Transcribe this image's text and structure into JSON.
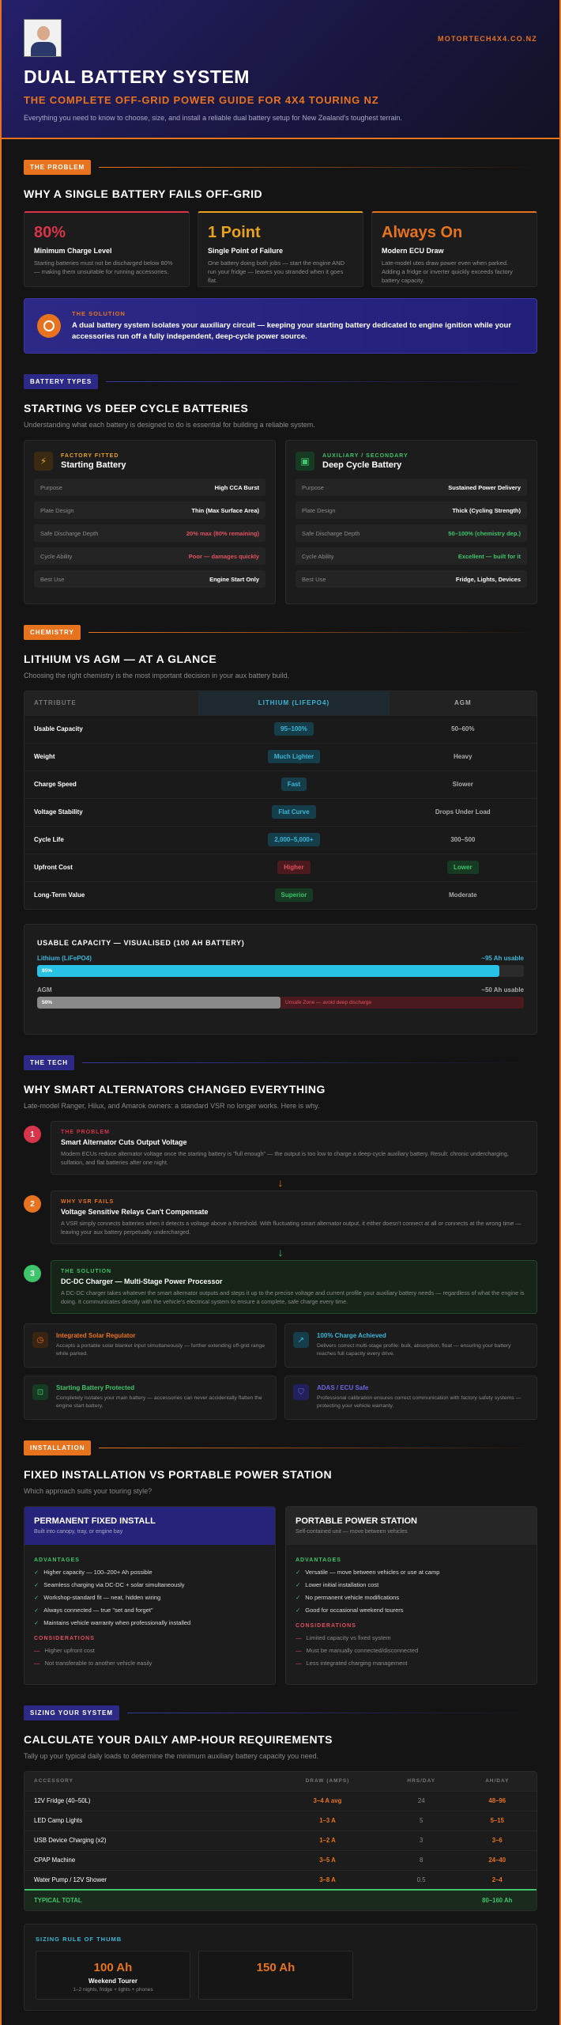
{
  "hero": {
    "site": "MOTORTECH4X4.CO.NZ",
    "title": "DUAL BATTERY SYSTEM",
    "subtitle": "THE COMPLETE OFF-GRID POWER GUIDE FOR 4X4 TOURING NZ",
    "intro": "Everything you need to know to choose, size, and install a reliable dual battery setup for New Zealand's toughest terrain."
  },
  "problem": {
    "tag": "THE PROBLEM",
    "title": "WHY A SINGLE BATTERY FAILS OFF-GRID",
    "cards": [
      {
        "big": "80%",
        "label": "Minimum Charge Level",
        "desc": "Starting batteries must not be discharged below 80% — making them unsuitable for running accessories.",
        "color": "#d8344a"
      },
      {
        "big": "1 Point",
        "label": "Single Point of Failure",
        "desc": "One battery doing both jobs — start the engine AND run your fridge — leaves you stranded when it goes flat.",
        "color": "#e8a21f"
      },
      {
        "big": "Always On",
        "label": "Modern ECU Draw",
        "desc": "Late-model utes draw power even when parked. Adding a fridge or inverter quickly exceeds factory battery capacity.",
        "color": "#e8731f"
      }
    ],
    "solution_kicker": "THE SOLUTION",
    "solution_text": "A dual battery system isolates your auxiliary circuit — keeping your starting battery dedicated to engine ignition while your accessories run off a fully independent, deep-cycle power source."
  },
  "types": {
    "tag": "BATTERY TYPES",
    "title": "STARTING VS DEEP CYCLE BATTERIES",
    "sub": "Understanding what each battery is designed to do is essential for building a reliable system.",
    "starting": {
      "kicker": "FACTORY FITTED",
      "name": "Starting Battery",
      "rows": [
        {
          "l": "Purpose",
          "v": "High CCA Burst",
          "c": "#ffffff"
        },
        {
          "l": "Plate Design",
          "v": "Thin (Max Surface Area)",
          "c": "#ffffff"
        },
        {
          "l": "Safe Discharge Depth",
          "v": "20% max (80% remaining)",
          "c": "#e05060"
        },
        {
          "l": "Cycle Ability",
          "v": "Poor — damages quickly",
          "c": "#e05060"
        },
        {
          "l": "Best Use",
          "v": "Engine Start Only",
          "c": "#ffffff"
        }
      ]
    },
    "deep": {
      "kicker": "AUXILIARY / SECONDARY",
      "name": "Deep Cycle Battery",
      "rows": [
        {
          "l": "Purpose",
          "v": "Sustained Power Delivery",
          "c": "#ffffff"
        },
        {
          "l": "Plate Design",
          "v": "Thick (Cycling Strength)",
          "c": "#ffffff"
        },
        {
          "l": "Safe Discharge Depth",
          "v": "50–100% (chemistry dep.)",
          "c": "#3ec46a"
        },
        {
          "l": "Cycle Ability",
          "v": "Excellent — built for it",
          "c": "#3ec46a"
        },
        {
          "l": "Best Use",
          "v": "Fridge, Lights, Devices",
          "c": "#ffffff"
        }
      ]
    }
  },
  "chem": {
    "tag": "CHEMISTRY",
    "title": "LITHIUM VS AGM — AT A GLANCE",
    "sub": "Choosing the right chemistry is the most important decision in your aux battery build.",
    "headers": [
      "ATTRIBUTE",
      "LITHIUM (LIFEPO4)",
      "AGM"
    ],
    "rows": [
      {
        "a": "Usable Capacity",
        "li": "95–100%",
        "lic": "cy",
        "ag": "50–60%",
        "agc": "plain"
      },
      {
        "a": "Weight",
        "li": "Much Lighter",
        "lic": "cy",
        "ag": "Heavy",
        "agc": "plain"
      },
      {
        "a": "Charge Speed",
        "li": "Fast",
        "lic": "cy",
        "ag": "Slower",
        "agc": "plain"
      },
      {
        "a": "Voltage Stability",
        "li": "Flat Curve",
        "lic": "cy",
        "ag": "Drops Under Load",
        "agc": "plain"
      },
      {
        "a": "Cycle Life",
        "li": "2,000–5,000+",
        "lic": "cy",
        "ag": "300–500",
        "agc": "plain"
      },
      {
        "a": "Upfront Cost",
        "li": "Higher",
        "lic": "rd",
        "ag": "Lower",
        "agc": "gr"
      },
      {
        "a": "Long-Term Value",
        "li": "Superior",
        "lic": "gr",
        "ag": "Moderate",
        "agc": "plain"
      }
    ],
    "cap_title": "USABLE CAPACITY — VISUALISED (100 AH BATTERY)",
    "li_label": "Lithium (LiFePO4)",
    "li_usable": "~95 Ah usable",
    "li_pct": "95%",
    "li_frac": 0.95,
    "agm_label": "AGM",
    "agm_usable": "~50 Ah usable",
    "agm_pct": "50%",
    "agm_frac": 0.5,
    "unsafe_label": "Unsafe Zone — avoid deep discharge"
  },
  "tech": {
    "tag": "THE TECH",
    "title": "WHY SMART ALTERNATORS CHANGED EVERYTHING",
    "sub": "Late-model Ranger, Hilux, and Amarok owners: a standard VSR no longer works. Here is why.",
    "steps": [
      {
        "n": "1",
        "k": "THE PROBLEM",
        "t": "Smart Alternator Cuts Output Voltage",
        "d": "Modern ECUs reduce alternator voltage once the starting battery is \"full enough\" — the output is too low to charge a deep-cycle auxiliary battery. Result: chronic undercharging, sulfation, and flat batteries after one night.",
        "color": "#d8344a"
      },
      {
        "n": "2",
        "k": "WHY VSR FAILS",
        "t": "Voltage Sensitive Relays Can't Compensate",
        "d": "A VSR simply connects batteries when it detects a voltage above a threshold. With fluctuating smart alternator output, it either doesn't connect at all or connects at the wrong time — leaving your aux battery perpetually undercharged.",
        "color": "#e8731f"
      },
      {
        "n": "3",
        "k": "THE SOLUTION",
        "t": "DC-DC Charger — Multi-Stage Power Processor",
        "d": "A DC-DC charger takes whatever the smart alternator outputs and steps it up to the precise voltage and current profile your auxiliary battery needs — regardless of what the engine is doing. It communicates directly with the vehicle's electrical system to ensure a complete, safe charge every time.",
        "color": "#3ec46a"
      }
    ],
    "features": [
      {
        "t": "Integrated Solar Regulator",
        "d": "Accepts a portable solar blanket input simultaneously — further extending off-grid range while parked.",
        "color": "#e8731f",
        "icon": "◷"
      },
      {
        "t": "100% Charge Achieved",
        "d": "Delivers correct multi-stage profile: bulk, absorption, float — ensuring your battery reaches full capacity every drive.",
        "color": "#3bb6d8",
        "icon": "↗"
      },
      {
        "t": "Starting Battery Protected",
        "d": "Completely isolates your main battery — accessories can never accidentally flatten the engine start battery.",
        "color": "#3ec46a",
        "icon": "🔒"
      },
      {
        "t": "ADAS / ECU Safe",
        "d": "Professional calibration ensures correct communication with factory safety systems — protecting your vehicle warranty.",
        "color": "#6a66e8",
        "icon": "⛉"
      }
    ]
  },
  "install": {
    "tag": "INSTALLATION",
    "title": "FIXED INSTALLATION VS PORTABLE POWER STATION",
    "sub": "Which approach suits your touring style?",
    "fixed": {
      "name": "PERMANENT FIXED INSTALL",
      "desc": "Built into canopy, tray, or engine bay",
      "adv_label": "ADVANTAGES",
      "adv": [
        "Higher capacity — 100–200+ Ah possible",
        "Seamless charging via DC-DC + solar simultaneously",
        "Workshop-standard fit — neat, hidden wiring",
        "Always connected — true \"set and forget\"",
        "Maintains vehicle warranty when professionally installed"
      ],
      "con_label": "CONSIDERATIONS",
      "con": [
        "Higher upfront cost",
        "Not transferable to another vehicle easily"
      ]
    },
    "portable": {
      "name": "PORTABLE POWER STATION",
      "desc": "Self-contained unit — move between vehicles",
      "adv_label": "ADVANTAGES",
      "adv": [
        "Versatile — move between vehicles or use at camp",
        "Lower initial installation cost",
        "No permanent vehicle modifications",
        "Good for occasional weekend tourers"
      ],
      "con_label": "CONSIDERATIONS",
      "con": [
        "Limited capacity vs fixed system",
        "Must be manually connected/disconnected",
        "Less integrated charging management"
      ]
    }
  },
  "sizing": {
    "tag": "SIZING YOUR SYSTEM",
    "title": "CALCULATE YOUR DAILY AMP-HOUR REQUIREMENTS",
    "sub": "Tally up your typical daily loads to determine the minimum auxiliary battery capacity you need.",
    "headers": [
      "ACCESSORY",
      "DRAW (AMPS)",
      "HRS/DAY",
      "AH/DAY"
    ],
    "rows": [
      {
        "a": "12V Fridge (40–50L)",
        "d": "3–4 A avg",
        "h": "24",
        "ah": "48–96"
      },
      {
        "a": "LED Camp Lights",
        "d": "1–3 A",
        "h": "5",
        "ah": "5–15"
      },
      {
        "a": "USB Device Charging (x2)",
        "d": "1–2 A",
        "h": "3",
        "ah": "3–6"
      },
      {
        "a": "CPAP Machine",
        "d": "3–5 A",
        "h": "8",
        "ah": "24–40"
      },
      {
        "a": "Water Pump / 12V Shower",
        "d": "3–8 A",
        "h": "0.5",
        "ah": "2–4"
      }
    ],
    "total_label": "TYPICAL TOTAL",
    "total_value": "80–160 Ah",
    "rule_label": "SIZING RULE OF THUMB",
    "rule_cards": [
      {
        "b": "100 Ah",
        "t": "Weekend Tourer",
        "s": "1–2 nights, fridge + lights + phones"
      },
      {
        "b": "150 Ah",
        "t": "",
        "s": ""
      }
    ]
  }
}
